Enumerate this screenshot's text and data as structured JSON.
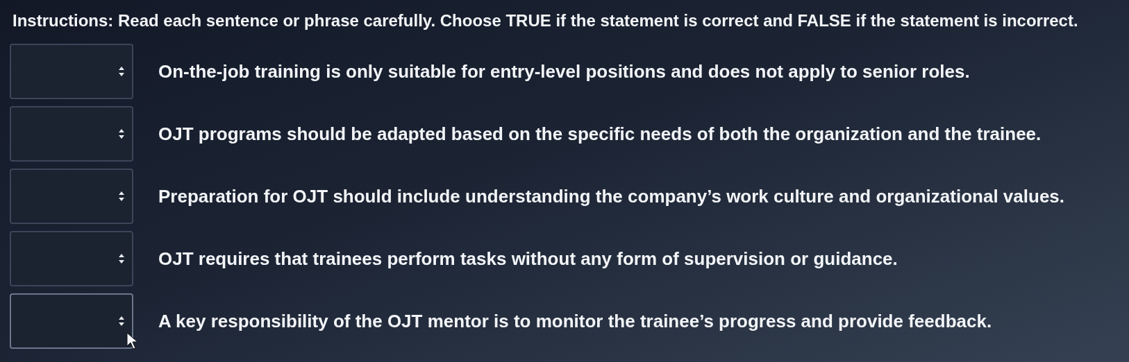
{
  "instructions": "Instructions: Read each sentence or phrase carefully. Choose TRUE if the statement is correct and FALSE if the statement is incorrect.",
  "items": [
    {
      "statement": "On-the-job training is only suitable for entry-level positions and does not apply to senior roles.",
      "pointer_over": false
    },
    {
      "statement": "OJT programs should be adapted based on the specific needs of both the organization and the trainee.",
      "pointer_over": false
    },
    {
      "statement": "Preparation for OJT should include understanding the company’s work culture and organizational values.",
      "pointer_over": false
    },
    {
      "statement": "OJT requires that trainees perform tasks without any form of supervision or guidance.",
      "pointer_over": false
    },
    {
      "statement": "A key responsibility of the OJT mentor is to monitor the trainee’s progress and provide feedback.",
      "pointer_over": true
    }
  ]
}
